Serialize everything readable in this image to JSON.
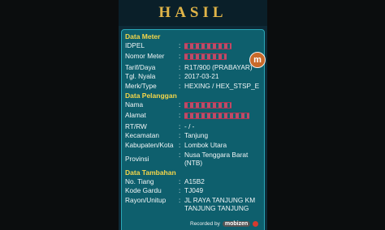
{
  "header": {
    "title": "HASIL"
  },
  "sections": {
    "meter": "Data Meter",
    "pelanggan": "Data Pelanggan",
    "tambahan": "Data Tambahan"
  },
  "meter": {
    "idpel": {
      "label": "IDPEL",
      "value": ""
    },
    "nomor_meter": {
      "label": "Nomor Meter",
      "value": ""
    },
    "tarif": {
      "label": "Tarif/Daya",
      "value": "R1T/900 (PRABAYAR)"
    },
    "tgl_nyala": {
      "label": "Tgl. Nyala",
      "value": "2017-03-21"
    },
    "merk": {
      "label": "Merk/Type",
      "value": "HEXING / HEX_STSP_E"
    }
  },
  "pelanggan": {
    "nama": {
      "label": "Nama",
      "value": ""
    },
    "alamat": {
      "label": "Alamat",
      "value": "DI                            R"
    },
    "rtrw": {
      "label": "RT/RW",
      "value": "- / -"
    },
    "kecamatan": {
      "label": "Kecamatan",
      "value": "Tanjung"
    },
    "kabupaten": {
      "label": "Kabupaten/Kota",
      "value": "Lombok Utara"
    },
    "provinsi": {
      "label": "Provinsi",
      "value": "Nusa Tenggara Barat (NTB)"
    }
  },
  "tambahan": {
    "tiang": {
      "label": "No. Tiang",
      "value": "A15B2"
    },
    "gardu": {
      "label": "Kode Gardu",
      "value": "TJ049"
    },
    "rayon": {
      "label": "Rayon/Unitup",
      "value": "JL RAYA TANJUNG KM TANJUNG TANJUNG"
    }
  },
  "separator": ":",
  "watermark": {
    "badge": "m",
    "recorder_text": "Recorded by",
    "recorder_brand": "mobizen"
  }
}
